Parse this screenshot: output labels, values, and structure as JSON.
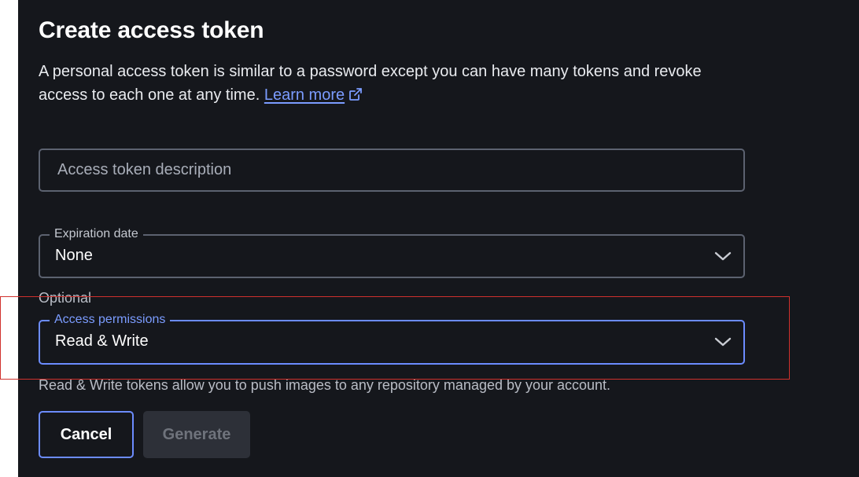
{
  "dialog": {
    "title": "Create access token",
    "description": "A personal access token is similar to a password except you can have many tokens and revoke access to each one at any time.",
    "learn_more_label": "Learn more"
  },
  "description_field": {
    "placeholder": "Access token description",
    "value": ""
  },
  "expiration": {
    "legend": "Expiration date",
    "selected": "None",
    "optional_label": "Optional"
  },
  "permissions": {
    "legend": "Access permissions",
    "selected": "Read & Write",
    "helper_text": "Read & Write tokens allow you to push images to any repository managed by your account."
  },
  "buttons": {
    "cancel_label": "Cancel",
    "generate_label": "Generate"
  },
  "icons": {
    "external_link": "external-link-icon",
    "chevron": "chevron-down-icon"
  },
  "colors": {
    "background": "#15171c",
    "accent": "#6c8cff",
    "link": "#7b9cff",
    "highlight": "#d0312d"
  }
}
